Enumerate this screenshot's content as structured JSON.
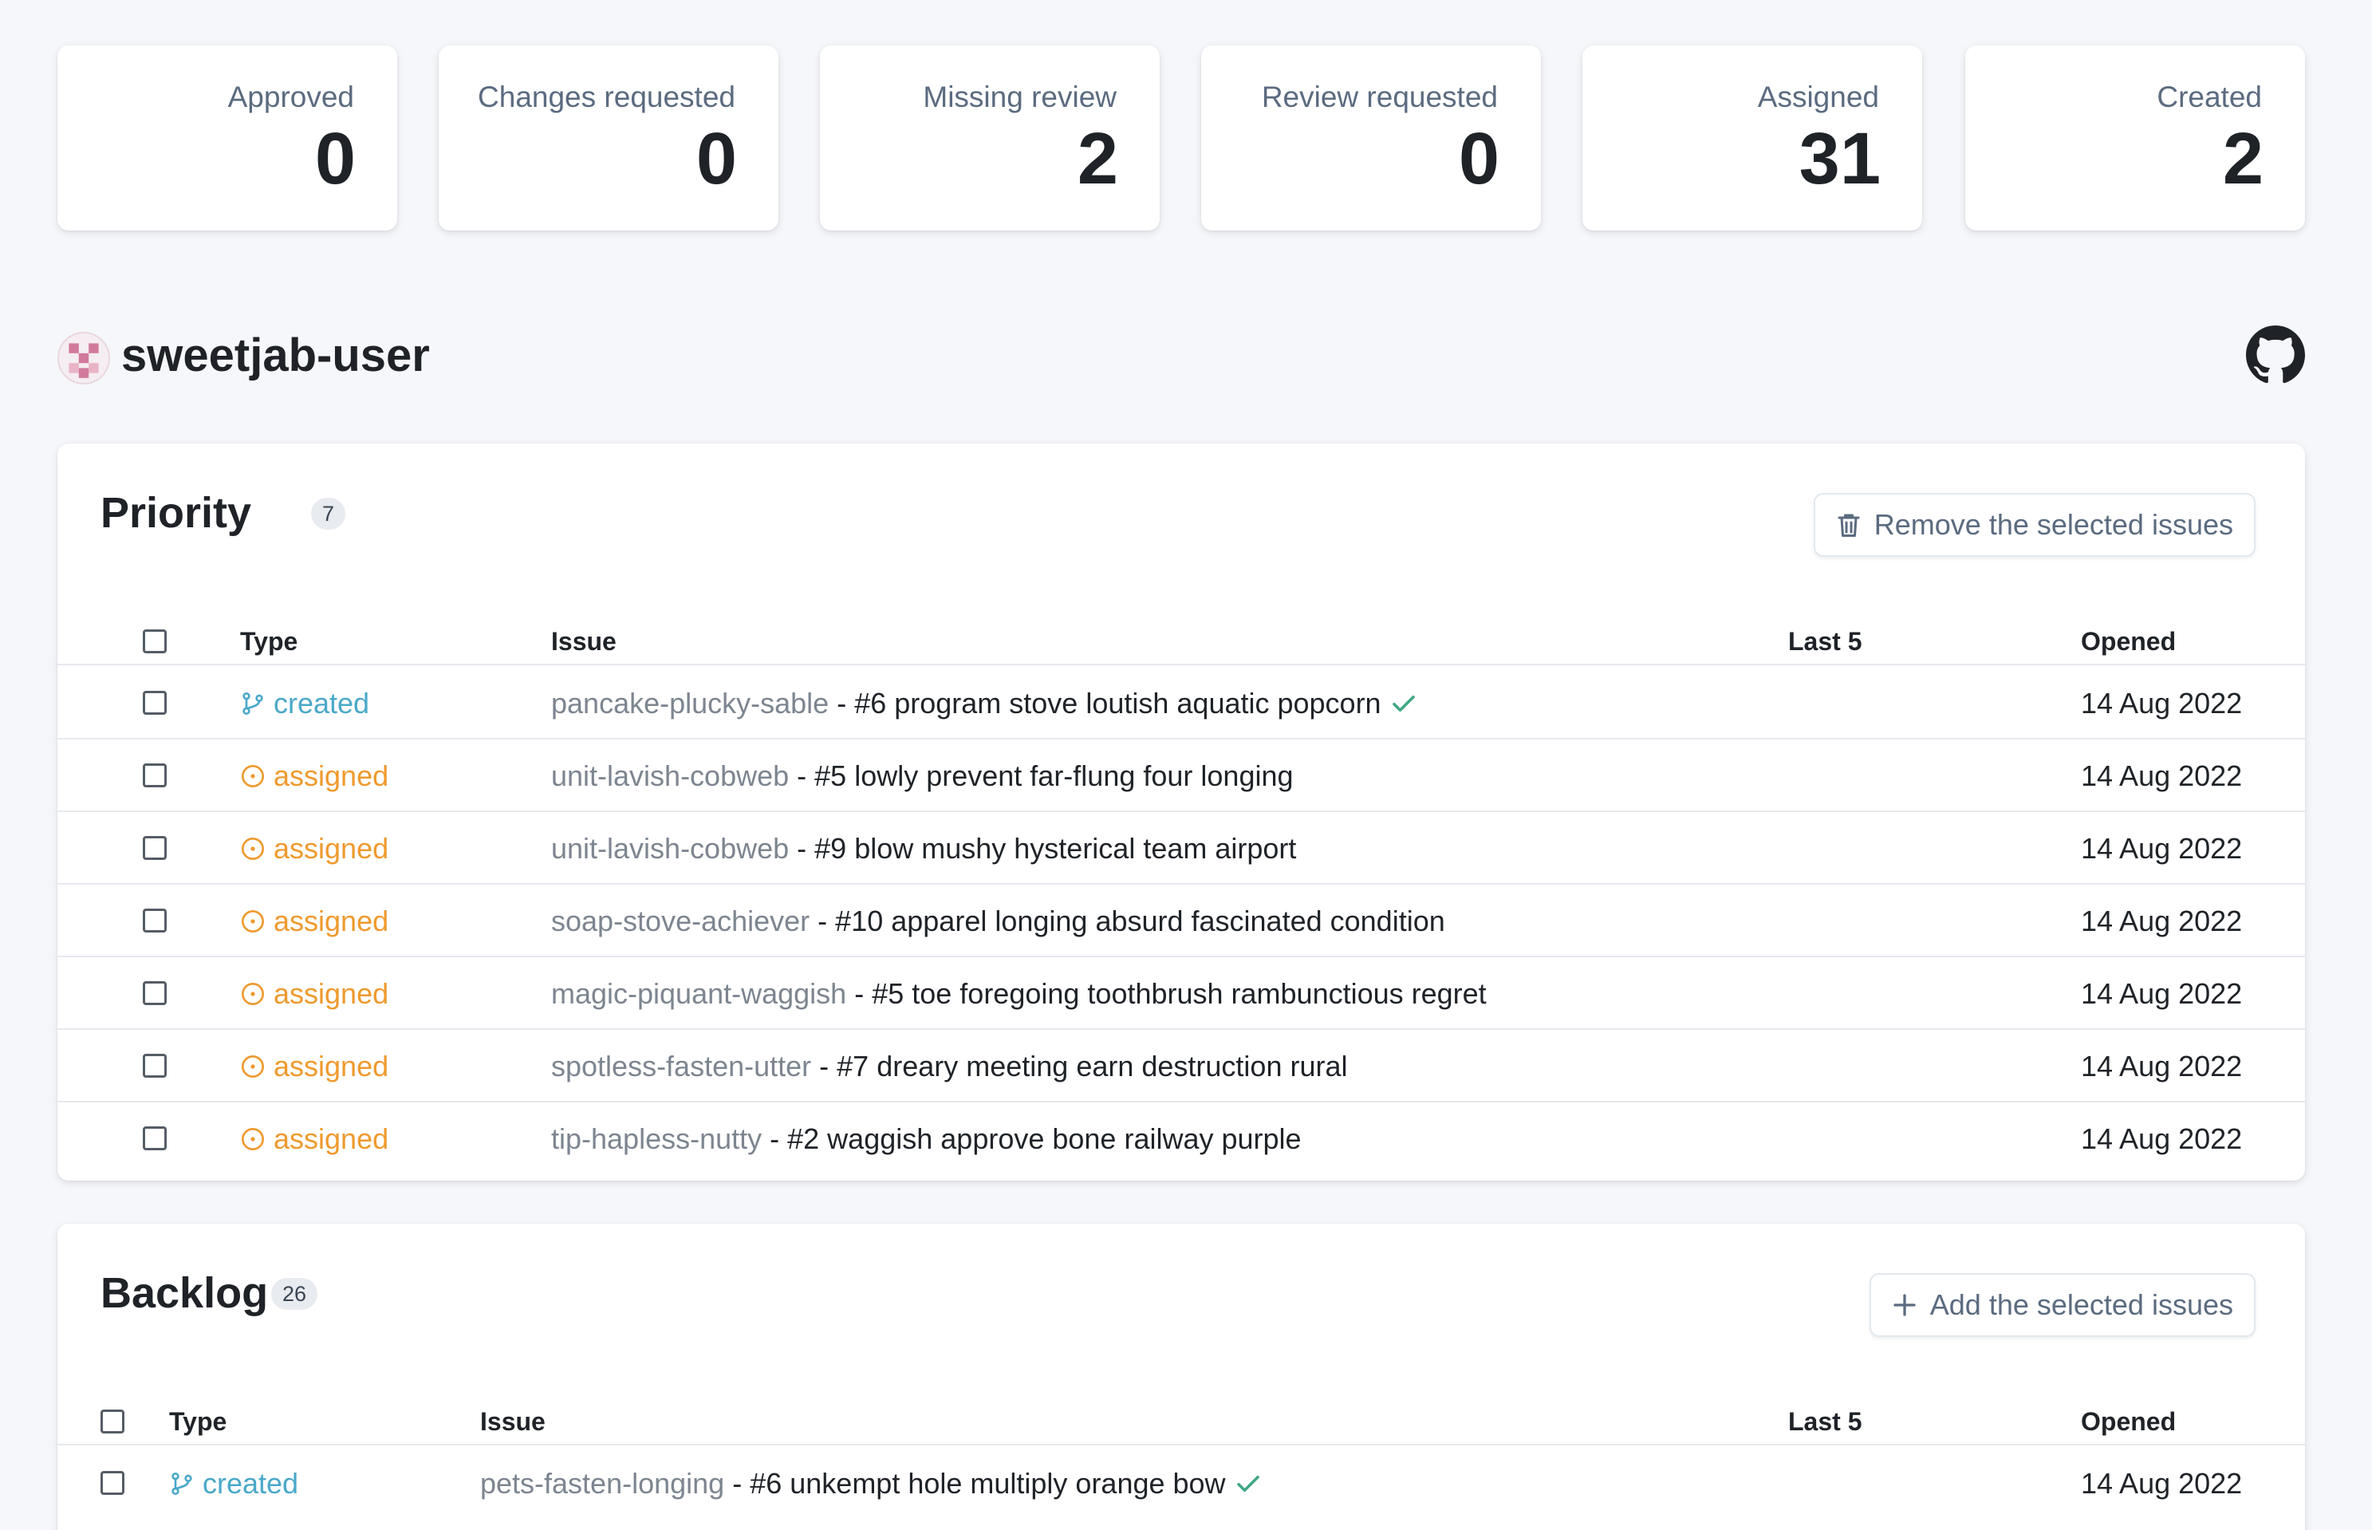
{
  "colors": {
    "created": "#4aa8c9",
    "assigned": "#ee9a2e",
    "check": "#3fa784",
    "muted": "#7d8590"
  },
  "stats": [
    {
      "label": "Approved",
      "value": "0"
    },
    {
      "label": "Changes requested",
      "value": "0"
    },
    {
      "label": "Missing review",
      "value": "2"
    },
    {
      "label": "Review requested",
      "value": "0"
    },
    {
      "label": "Assigned",
      "value": "31"
    },
    {
      "label": "Created",
      "value": "2"
    }
  ],
  "user": {
    "name": "sweetjab-user",
    "avatar_icon": "identicon-avatar",
    "link_icon": "github-icon"
  },
  "columns": {
    "type": "Type",
    "issue": "Issue",
    "last5": "Last 5",
    "opened": "Opened"
  },
  "priority": {
    "title": "Priority",
    "count": "7",
    "action_label": "Remove the selected issues",
    "action_icon": "trash-icon",
    "rows": [
      {
        "type": "created",
        "repo": "pancake-plucky-sable",
        "sep": " - ",
        "title": "#6 program stove loutish aquatic popcorn",
        "approved": true,
        "opened": "14 Aug 2022"
      },
      {
        "type": "assigned",
        "repo": "unit-lavish-cobweb",
        "sep": " - ",
        "title": "#5 lowly prevent far-flung four longing",
        "approved": false,
        "opened": "14 Aug 2022"
      },
      {
        "type": "assigned",
        "repo": "unit-lavish-cobweb",
        "sep": " - ",
        "title": "#9 blow mushy hysterical team airport",
        "approved": false,
        "opened": "14 Aug 2022"
      },
      {
        "type": "assigned",
        "repo": "soap-stove-achiever",
        "sep": " - ",
        "title": "#10 apparel longing absurd fascinated condition",
        "approved": false,
        "opened": "14 Aug 2022"
      },
      {
        "type": "assigned",
        "repo": "magic-piquant-waggish",
        "sep": " - ",
        "title": "#5 toe foregoing toothbrush rambunctious regret",
        "approved": false,
        "opened": "14 Aug 2022"
      },
      {
        "type": "assigned",
        "repo": "spotless-fasten-utter",
        "sep": " - ",
        "title": "#7 dreary meeting earn destruction rural",
        "approved": false,
        "opened": "14 Aug 2022"
      },
      {
        "type": "assigned",
        "repo": "tip-hapless-nutty",
        "sep": " - ",
        "title": "#2 waggish approve bone railway purple",
        "approved": false,
        "opened": "14 Aug 2022"
      }
    ]
  },
  "backlog": {
    "title": "Backlog",
    "count": "26",
    "action_label": "Add the selected issues",
    "action_icon": "plus-icon",
    "rows": [
      {
        "type": "created",
        "repo": "pets-fasten-longing",
        "sep": " - ",
        "title": "#6 unkempt hole multiply orange bow",
        "approved": true,
        "opened": "14 Aug 2022"
      }
    ]
  }
}
